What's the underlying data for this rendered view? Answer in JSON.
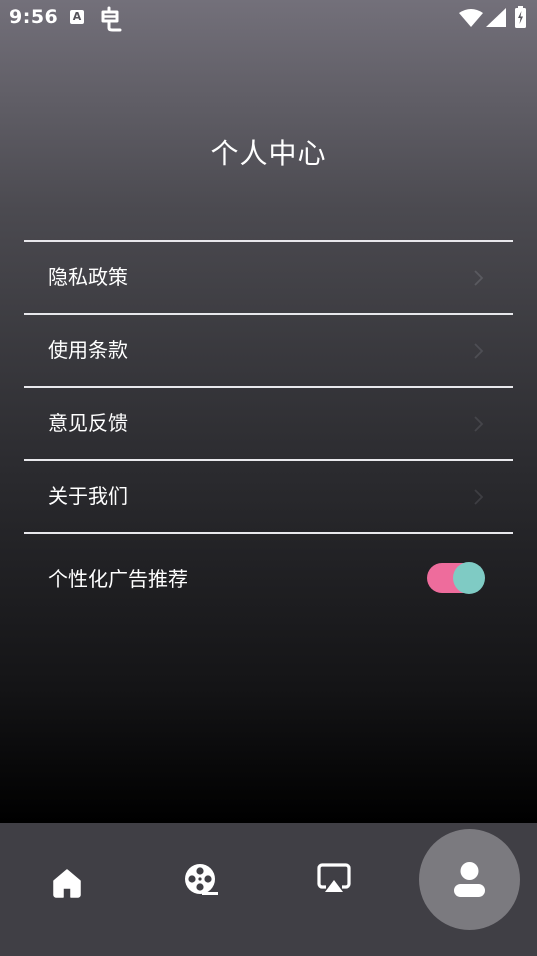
{
  "status_bar": {
    "time": "9:56",
    "notification_a": "A",
    "icons": [
      "accessibility-a-icon",
      "bug-icon",
      "wifi-icon",
      "signal-icon",
      "battery-icon"
    ]
  },
  "header": {
    "title": "个人中心"
  },
  "menu": {
    "items": [
      {
        "label": "隐私政策",
        "icon": "chevron-right-icon"
      },
      {
        "label": "使用条款",
        "icon": "chevron-right-icon"
      },
      {
        "label": "意见反馈",
        "icon": "chevron-right-icon"
      },
      {
        "label": "关于我们",
        "icon": "chevron-right-icon"
      }
    ],
    "toggle": {
      "label": "个性化广告推荐",
      "on": true
    }
  },
  "bottom_nav": {
    "items": [
      {
        "icon": "home-icon",
        "active": false
      },
      {
        "icon": "film-reel-icon",
        "active": false
      },
      {
        "icon": "cast-screen-icon",
        "active": false
      },
      {
        "icon": "profile-icon",
        "active": true
      }
    ]
  },
  "colors": {
    "toggle_track": "#ee6c9c",
    "toggle_thumb": "#7fcbc4",
    "nav_background": "#403f45",
    "nav_active_circle": "#7b7a7f",
    "divider": "#e8e8ec"
  }
}
